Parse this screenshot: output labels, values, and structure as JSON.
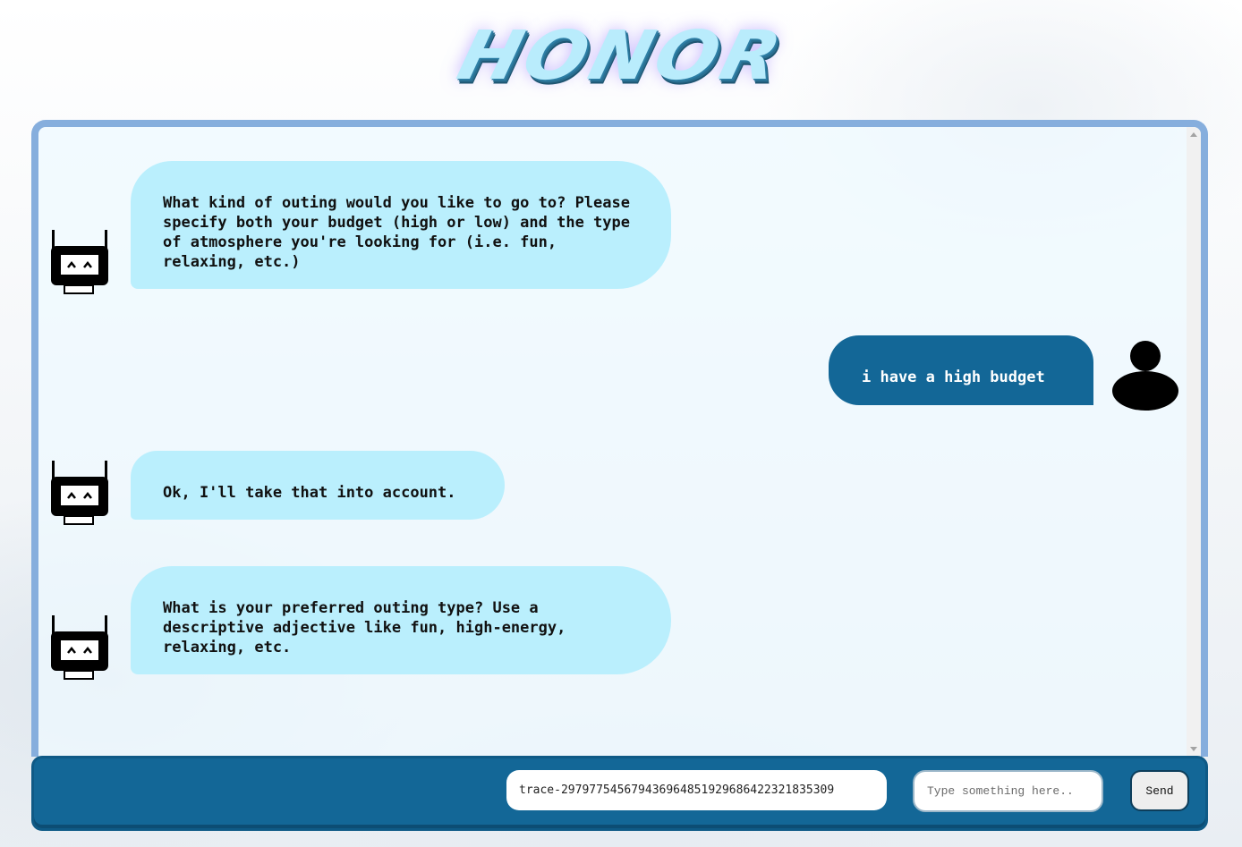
{
  "header": {
    "logo_text": "HONOR"
  },
  "chat": {
    "messages": [
      {
        "sender": "bot",
        "icon": "robot-icon",
        "text": "What kind of outing would you like to go to? Please specify both your budget (high or low) and the type of atmosphere you're looking for (i.e. fun, relaxing, etc.)"
      },
      {
        "sender": "user",
        "icon": "user-icon",
        "text": "i have a high budget"
      },
      {
        "sender": "bot",
        "icon": "robot-icon",
        "text": "Ok, I'll take that into account."
      },
      {
        "sender": "bot",
        "icon": "robot-icon",
        "text": "What is your preferred outing type? Use a descriptive adjective like fun, high-energy, relaxing, etc."
      }
    ]
  },
  "input_bar": {
    "trace_value": "trace-297977545679436964851929686422321835309",
    "message_placeholder": "Type something here..",
    "send_label": "Send"
  },
  "colors": {
    "bot_bubble": "#baeffd",
    "user_bubble": "#136797",
    "frame_border": "#86aedd",
    "input_bar": "#136797"
  }
}
